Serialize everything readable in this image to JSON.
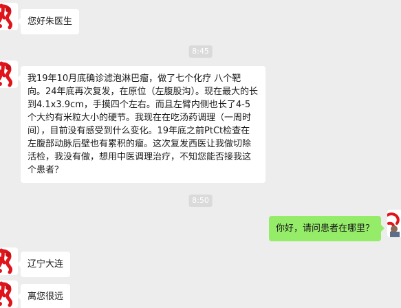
{
  "messages": [
    {
      "side": "left",
      "text": "您好朱医生"
    },
    {
      "side": "left",
      "text": "我19年10月底确诊滤泡淋巴瘤，做了七个化疗 八个靶向。24年底再次复发，在原位（左腹股沟）。现在最大的长到4.1x3.9cm，手摸四个左右。而且左臂内侧也长了4-5个大约有米粒大小的硬节。我现在在吃汤药调理（一周时间），目前没有感受到什么变化。19年底之前PtCt检查在左腹部动脉后壁也有累积的瘤。这次复发西医让我做切除活检，我没有做，想用中医调理治疗，不知您能否接我这个患者？"
    },
    {
      "side": "right",
      "text": "你好，请问患者在哪里？"
    },
    {
      "side": "left",
      "text": "辽宁大连"
    },
    {
      "side": "left",
      "text": "离您很远"
    }
  ],
  "timestamps": [
    "8:45",
    "8:50"
  ],
  "colors": {
    "background": "#ededed",
    "incoming_bubble": "#ffffff",
    "outgoing_bubble": "#95ec69",
    "timestamp_bg": "#dadada",
    "avatar_accent": "#e0141b"
  }
}
